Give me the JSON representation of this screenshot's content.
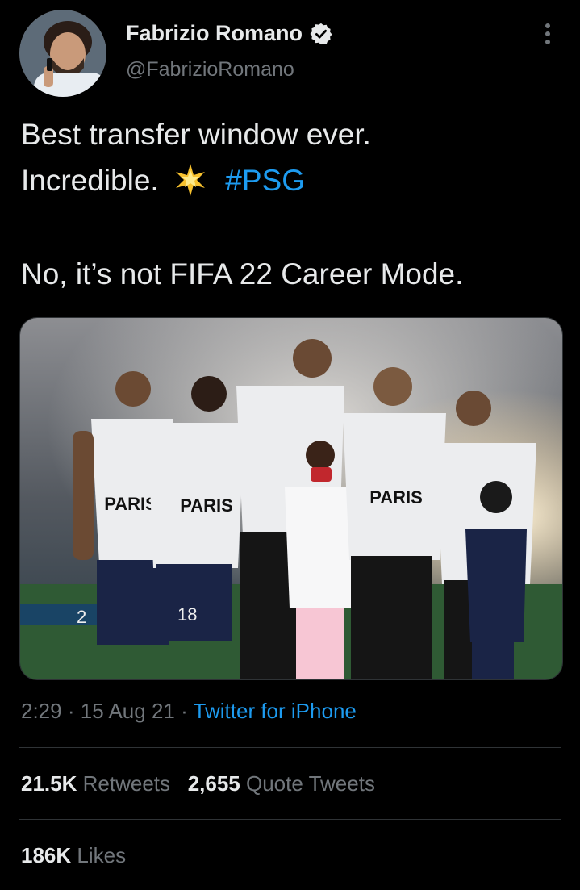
{
  "author": {
    "name": "Fabrizio Romano",
    "handle": "@FabrizioRomano",
    "verified_icon": "verified-badge-icon"
  },
  "tweet": {
    "line1": "Best transfer window ever.",
    "line2_text": "Incredible.",
    "line2_emoji": "glowing-star-icon",
    "hashtag": "#PSG",
    "line3": "No, it’s not FIFA 22 Career Mode."
  },
  "media": {
    "shirt_text": "PARIS",
    "numbers": [
      "2",
      "18"
    ]
  },
  "meta": {
    "time": "2:29",
    "sep1": "·",
    "date": "15 Aug 21",
    "sep2": "·",
    "source": "Twitter for iPhone"
  },
  "stats": {
    "retweets_count": "21.5K",
    "retweets_label": "Retweets",
    "quotes_count": "2,655",
    "quotes_label": "Quote Tweets",
    "likes_count": "186K",
    "likes_label": "Likes"
  },
  "colors": {
    "background": "#000000",
    "text": "#e7e9ea",
    "secondary": "#71767b",
    "accent": "#1d9bf0",
    "divider": "#2f3336"
  }
}
